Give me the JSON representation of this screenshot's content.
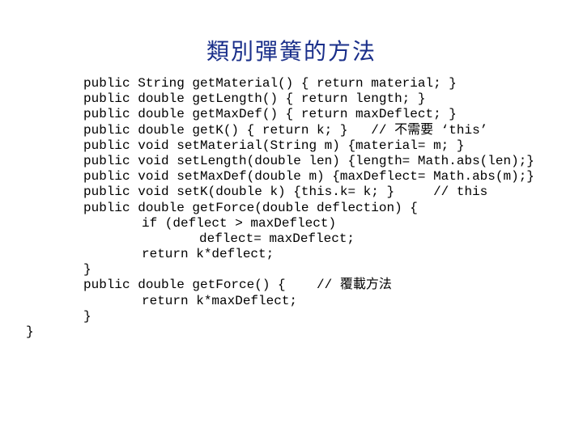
{
  "title": "類別彈簧的方法",
  "code_lines": [
    {
      "indent": 103,
      "text": "public String getMaterial() { return material; }"
    },
    {
      "indent": 103,
      "text": "public double getLength() { return length; }"
    },
    {
      "indent": 103,
      "text": "public double getMaxDef() { return maxDeflect; }"
    },
    {
      "indent": 103,
      "text": "public double getK() { return k; }   // 不需要 ‘this’"
    },
    {
      "indent": 103,
      "text": "public void setMaterial(String m) {material= m; }"
    },
    {
      "indent": 103,
      "text": "public void setLength(double len) {length= Math.abs(len);}"
    },
    {
      "indent": 103,
      "text": "public void setMaxDef(double m) {maxDeflect= Math.abs(m);}"
    },
    {
      "indent": 103,
      "text": "public void setK(double k) {this.k= k; }     // this"
    },
    {
      "indent": 103,
      "text": "public double getForce(double deflection) {"
    },
    {
      "indent": 175,
      "text": "if (deflect > maxDeflect)"
    },
    {
      "indent": 246,
      "text": "deflect= maxDeflect;"
    },
    {
      "indent": 175,
      "text": "return k*deflect;"
    },
    {
      "indent": 103,
      "text": "}"
    },
    {
      "indent": 103,
      "text": "public double getForce() {    // 覆載方法"
    },
    {
      "indent": 175,
      "text": "return k*maxDeflect;"
    },
    {
      "indent": 103,
      "text": "}"
    },
    {
      "indent": 32,
      "text": "}"
    }
  ]
}
